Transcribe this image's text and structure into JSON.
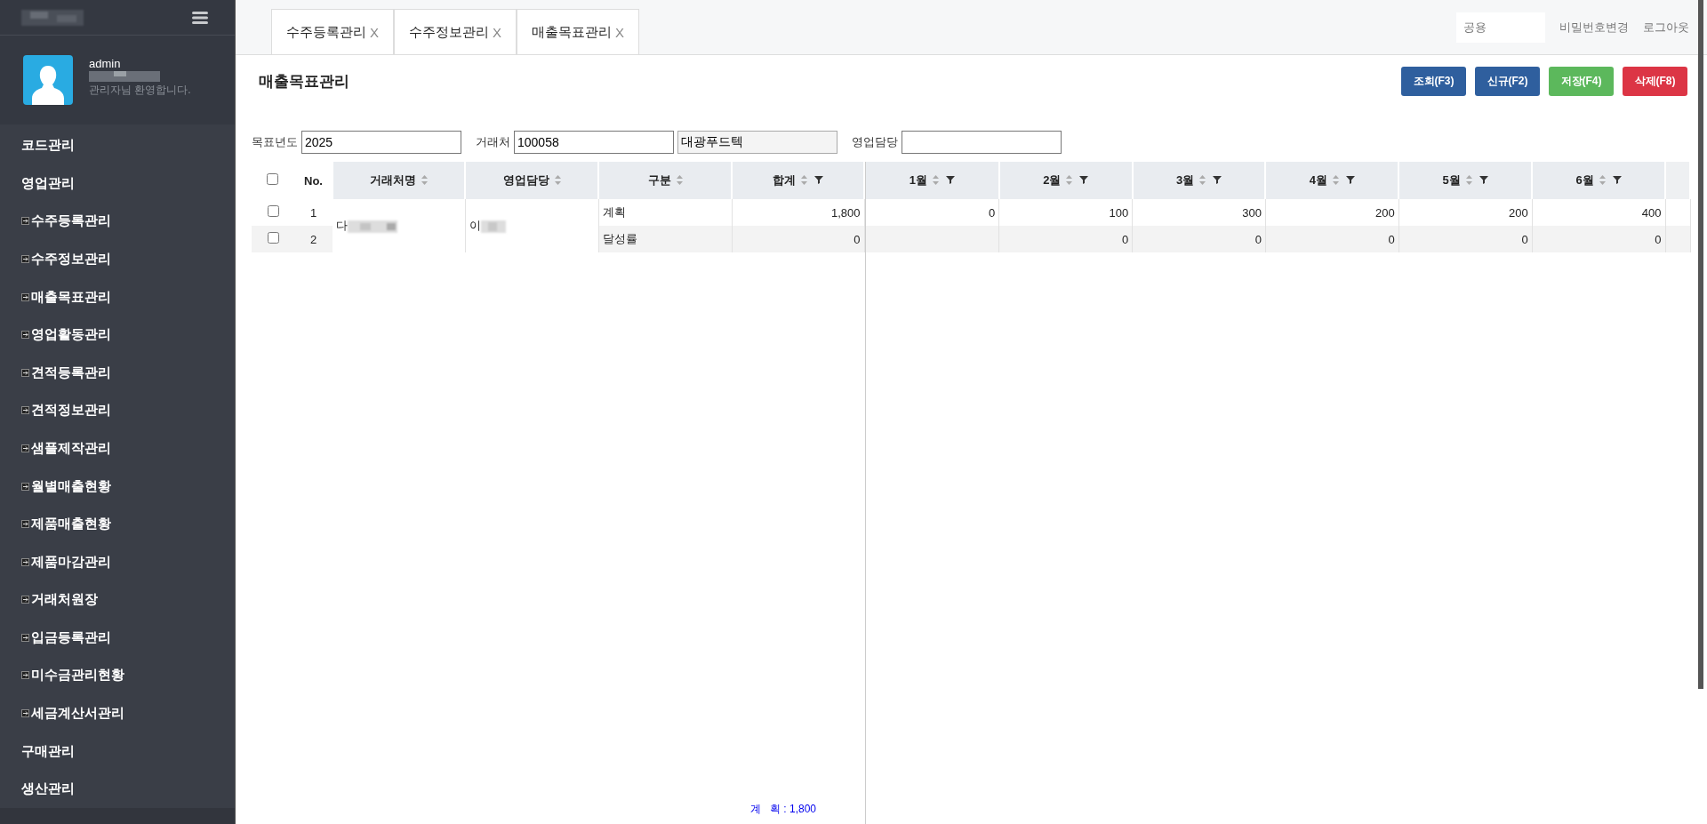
{
  "sidebar": {
    "user": {
      "name": "admin",
      "greeting": "관리자님 환영합니다."
    },
    "items": [
      {
        "label": "코드관리",
        "kind": "group"
      },
      {
        "label": "영업관리",
        "kind": "group"
      },
      {
        "label": "수주등록관리",
        "kind": "page"
      },
      {
        "label": "수주정보관리",
        "kind": "page"
      },
      {
        "label": "매출목표관리",
        "kind": "page"
      },
      {
        "label": "영업활동관리",
        "kind": "page"
      },
      {
        "label": "견적등록관리",
        "kind": "page"
      },
      {
        "label": "견적정보관리",
        "kind": "page"
      },
      {
        "label": "샘플제작관리",
        "kind": "page"
      },
      {
        "label": "월별매출현황",
        "kind": "page"
      },
      {
        "label": "제품매출현황",
        "kind": "page"
      },
      {
        "label": "제품마감관리",
        "kind": "page"
      },
      {
        "label": "거래처원장",
        "kind": "page"
      },
      {
        "label": "입금등록관리",
        "kind": "page"
      },
      {
        "label": "미수금관리현황",
        "kind": "page"
      },
      {
        "label": "세금계산서관리",
        "kind": "page"
      },
      {
        "label": "구매관리",
        "kind": "group"
      },
      {
        "label": "생산관리",
        "kind": "group"
      }
    ]
  },
  "tabs": [
    {
      "label": "수주등록관리",
      "close": "X"
    },
    {
      "label": "수주정보관리",
      "close": "X"
    },
    {
      "label": "매출목표관리",
      "close": "X"
    }
  ],
  "header": {
    "search": {
      "placeholder": "공용"
    },
    "links": [
      "비밀번호변경",
      "로그아웃"
    ]
  },
  "page": {
    "title": "매출목표관리",
    "buttons": [
      {
        "label": "조회(F3)",
        "kind": "search"
      },
      {
        "label": "신규(F2)",
        "kind": "new"
      },
      {
        "label": "저장(F4)",
        "kind": "save"
      },
      {
        "label": "삭제(F8)",
        "kind": "delete"
      }
    ],
    "filters": [
      {
        "label": "목표년도",
        "value": "2025"
      },
      {
        "label": "거래처",
        "value": "100058",
        "name": "대광푸드텍"
      },
      {
        "label": "영업담당"
      }
    ]
  },
  "grid": {
    "columns": [
      {
        "label": "No.",
        "sortable": false,
        "filter": false
      },
      {
        "label": "거래처명",
        "sortable": true,
        "filter": false
      },
      {
        "label": "영업담당",
        "sortable": true,
        "filter": false
      },
      {
        "label": "구분",
        "sortable": true,
        "filter": false
      },
      {
        "label": "합계",
        "sortable": true,
        "filter": true
      },
      {
        "label": "1월",
        "sortable": true,
        "filter": true
      },
      {
        "label": "2월",
        "sortable": true,
        "filter": true
      },
      {
        "label": "3월",
        "sortable": true,
        "filter": true
      },
      {
        "label": "4월",
        "sortable": true,
        "filter": true
      },
      {
        "label": "5월",
        "sortable": true,
        "filter": true
      },
      {
        "label": "6월",
        "sortable": true,
        "filter": true
      }
    ],
    "header_checked": false,
    "customer": "다",
    "staff": "이",
    "rows": [
      {
        "checked": false,
        "no": "1",
        "type": "계획",
        "total": "1,800",
        "months": {
          "m1": "0",
          "m2": "100",
          "m3": "300",
          "m4": "200",
          "m5": "200",
          "m6": "400"
        }
      },
      {
        "checked": false,
        "no": "2",
        "type": "달성률",
        "total": "0",
        "months": {
          "m2": "0",
          "m3": "0",
          "m4": "0",
          "m5": "0",
          "m6": "0"
        }
      }
    ],
    "summary": "계   획 : 1,800"
  }
}
